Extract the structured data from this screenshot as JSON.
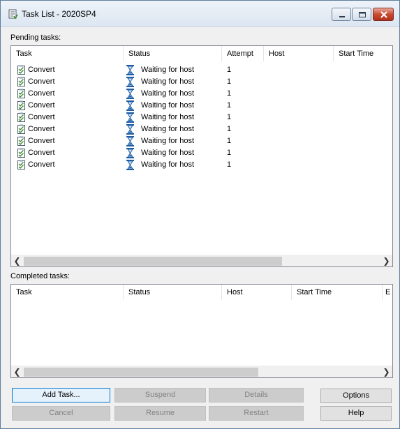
{
  "window": {
    "title": "Task List - 2020SP4",
    "controls": [
      "minimize",
      "maximize",
      "close"
    ]
  },
  "pending": {
    "label": "Pending tasks:",
    "columns": [
      "Task",
      "Status",
      "Attempt",
      "Host",
      "Start Time"
    ],
    "rows": [
      {
        "task": "Convert",
        "status": "Waiting for host",
        "attempt": "1",
        "host": "",
        "start_time": ""
      },
      {
        "task": "Convert",
        "status": "Waiting for host",
        "attempt": "1",
        "host": "",
        "start_time": ""
      },
      {
        "task": "Convert",
        "status": "Waiting for host",
        "attempt": "1",
        "host": "",
        "start_time": ""
      },
      {
        "task": "Convert",
        "status": "Waiting for host",
        "attempt": "1",
        "host": "",
        "start_time": ""
      },
      {
        "task": "Convert",
        "status": "Waiting for host",
        "attempt": "1",
        "host": "",
        "start_time": ""
      },
      {
        "task": "Convert",
        "status": "Waiting for host",
        "attempt": "1",
        "host": "",
        "start_time": ""
      },
      {
        "task": "Convert",
        "status": "Waiting for host",
        "attempt": "1",
        "host": "",
        "start_time": ""
      },
      {
        "task": "Convert",
        "status": "Waiting for host",
        "attempt": "1",
        "host": "",
        "start_time": ""
      },
      {
        "task": "Convert",
        "status": "Waiting for host",
        "attempt": "1",
        "host": "",
        "start_time": ""
      }
    ],
    "task_icon": "checklist-icon",
    "status_icon": "hourglass-icon"
  },
  "completed": {
    "label": "Completed tasks:",
    "columns": [
      "Task",
      "Status",
      "Host",
      "Start Time",
      "E"
    ],
    "rows": []
  },
  "buttons": {
    "add_task": "Add Task...",
    "suspend": "Suspend",
    "details": "Details",
    "options": "Options",
    "cancel": "Cancel",
    "resume": "Resume",
    "restart": "Restart",
    "help": "Help"
  },
  "colors": {
    "close_button": "#c84a31",
    "hourglass": "#1e5ea8",
    "focus_border": "#0078d7",
    "check_icon": "#3c8a2e"
  }
}
